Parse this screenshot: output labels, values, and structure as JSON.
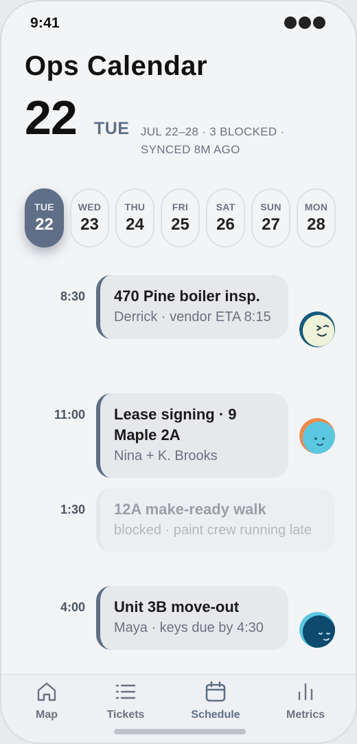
{
  "status": {
    "time": "9:41"
  },
  "header": {
    "title": "Ops Calendar",
    "date_number": "22",
    "day_of_week": "TUE",
    "summary": "JUL 22–28 · 3 BLOCKED · SYNCED 8M AGO"
  },
  "week": [
    {
      "dow": "TUE",
      "num": "22",
      "selected": true
    },
    {
      "dow": "WED",
      "num": "23"
    },
    {
      "dow": "THU",
      "num": "24"
    },
    {
      "dow": "FRI",
      "num": "25"
    },
    {
      "dow": "SAT",
      "num": "26"
    },
    {
      "dow": "SUN",
      "num": "27"
    },
    {
      "dow": "MON",
      "num": "28"
    }
  ],
  "events": [
    {
      "time": "8:30",
      "title": "470 Pine boiler insp.",
      "detail": "Derrick · vendor ETA 8:15",
      "status": "scheduled",
      "avatar": "winking-face"
    },
    {
      "time": "11:00",
      "title": "Lease signing · 9 Maple 2A",
      "detail": "Nina + K. Brooks",
      "status": "scheduled",
      "avatar": "smiling-face"
    },
    {
      "time": "1:30",
      "title": "12A make-ready walk",
      "detail": "blocked · paint crew running late",
      "status": "blocked"
    },
    {
      "time": "4:00",
      "title": "Unit 3B move-out",
      "detail": "Maya · keys due by 4:30",
      "status": "scheduled",
      "avatar": "sleepy-face"
    }
  ],
  "tabs": [
    {
      "label": "Map",
      "icon": "home-icon"
    },
    {
      "label": "Tickets",
      "icon": "list-icon"
    },
    {
      "label": "Schedule",
      "icon": "calendar-icon",
      "active": true
    },
    {
      "label": "Metrics",
      "icon": "bar-chart-icon"
    }
  ],
  "colors": {
    "accent": "#5f6f87",
    "background": "#f3f4f6",
    "card": "#e7e8ec"
  }
}
